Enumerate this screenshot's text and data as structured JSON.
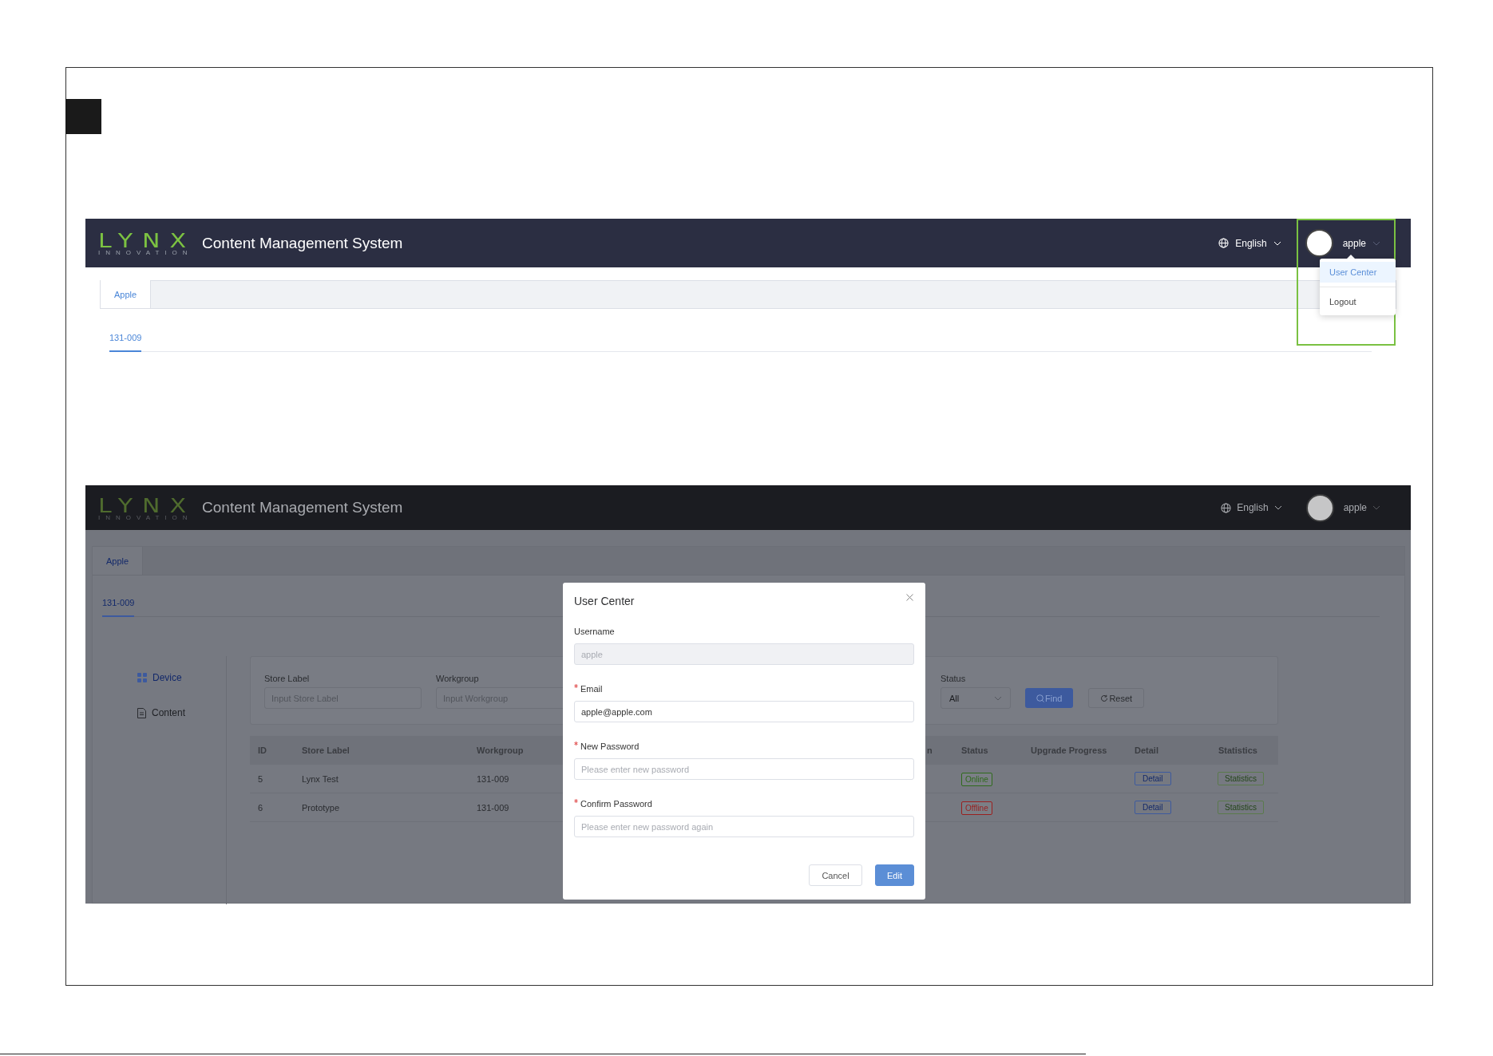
{
  "screenshot_1": {
    "header": {
      "logo": "LYNX",
      "logo_tagline": "INNOVATION",
      "title": "Content Management System",
      "language": "English",
      "username": "apple"
    },
    "tabs": [
      {
        "label": "Apple",
        "selected": true
      }
    ],
    "subtabs": [
      {
        "label": "131-009",
        "selected": true
      }
    ],
    "user_menu": {
      "highlighted": true,
      "items": [
        {
          "label": "User Center",
          "selected": true
        },
        {
          "label": "Logout",
          "selected": false
        }
      ]
    }
  },
  "screenshot_2": {
    "header": {
      "logo": "LYNX",
      "logo_tagline": "INNOVATION",
      "title": "Content Management System",
      "language": "English",
      "username": "apple"
    },
    "tabs": [
      {
        "label": "Apple",
        "selected": true
      }
    ],
    "subtabs": [
      {
        "label": "131-009",
        "selected": true
      }
    ],
    "sidebar": {
      "items": [
        {
          "label": "Device",
          "kind": "grid",
          "selected": true
        },
        {
          "label": "Content",
          "kind": "document",
          "selected": false
        }
      ]
    },
    "filters": [
      {
        "label": "Store Label",
        "placeholder": "Input Store Label",
        "kind": "input"
      },
      {
        "label": "Workgroup",
        "placeholder": "Input Workgroup",
        "kind": "input"
      },
      {
        "label": "Status",
        "value": "All",
        "kind": "select"
      }
    ],
    "filter_buttons": [
      {
        "label": "Find",
        "kind": "primary"
      },
      {
        "label": "Reset",
        "kind": "default"
      }
    ],
    "table": {
      "columns": [
        "ID",
        "Store Label",
        "Workgroup",
        "n",
        "Status",
        "Upgrade Progress",
        "Detail",
        "Statistics"
      ],
      "rows": [
        {
          "id": "5",
          "store_label": "Lynx Test",
          "workgroup": "131-009",
          "status": "Online",
          "color": "#2f6a1c",
          "detail": "Detail",
          "statistics": "Statistics"
        },
        {
          "id": "6",
          "store_label": "Prototype",
          "workgroup": "131-009",
          "status": "Offline",
          "color": "#9a1f1f",
          "detail": "Detail",
          "statistics": "Statistics"
        }
      ]
    },
    "dialog": {
      "title": "User Center",
      "fields": [
        {
          "label": "Username",
          "value": "apple",
          "required": false,
          "disabled": true
        },
        {
          "label": "Email",
          "value": "apple@apple.com",
          "required": true,
          "disabled": false
        },
        {
          "label": "New Password",
          "placeholder": "Please enter new password",
          "required": true,
          "disabled": false
        },
        {
          "label": "Confirm Password",
          "placeholder": "Please enter new password again",
          "required": true,
          "disabled": false
        }
      ],
      "buttons": [
        {
          "label": "Cancel",
          "kind": "default"
        },
        {
          "label": "Edit",
          "kind": "primary"
        }
      ]
    }
  }
}
